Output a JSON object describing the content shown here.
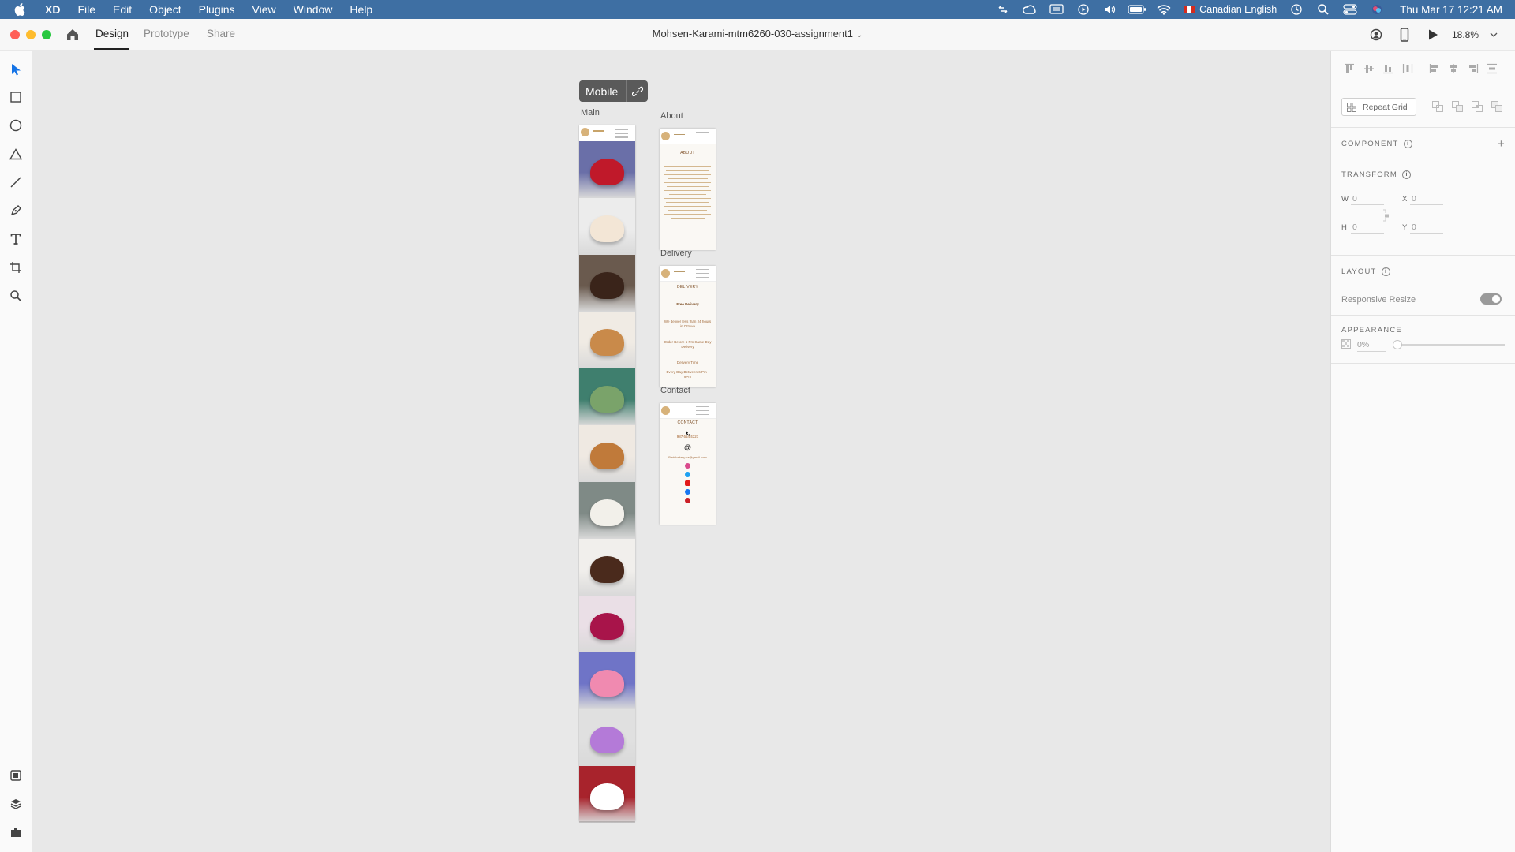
{
  "menubar": {
    "apple_icon": "apple-logo-icon",
    "items": [
      "XD",
      "File",
      "Edit",
      "Object",
      "Plugins",
      "View",
      "Window",
      "Help"
    ],
    "input_source": "Canadian English",
    "clock": "Thu Mar 17  12:21 AM",
    "tray_icons": [
      "cloud-sync-icon",
      "creative-cloud-icon",
      "display-icon",
      "play-circle-icon",
      "volume-icon",
      "battery-icon",
      "wifi-icon",
      "flag-canada-icon",
      "time-machine-icon",
      "spotlight-icon",
      "control-center-icon",
      "siri-icon"
    ]
  },
  "toolbar": {
    "tabs": [
      "Design",
      "Prototype",
      "Share"
    ],
    "active_tab": "Design",
    "document_title": "Mohsen-Karami-mtm6260-030-assignment1",
    "zoom": "18.8%",
    "right_icons": [
      "user-account-icon",
      "mobile-preview-icon",
      "play-icon"
    ]
  },
  "tools": [
    "select-icon",
    "rectangle-icon",
    "ellipse-icon",
    "polygon-icon",
    "line-icon",
    "pen-icon",
    "text-icon",
    "artboard-icon",
    "zoom-icon"
  ],
  "bottom_tools": [
    "assets-icon",
    "layers-icon",
    "plugins-icon"
  ],
  "canvas": {
    "flow_name": "Mobile",
    "artboards": {
      "main": "Main",
      "about": "About",
      "delivery": "Delivery",
      "contact": "Contact"
    },
    "about_content": {
      "title": "ABOUT"
    },
    "delivery_content": {
      "title": "DELIVERY",
      "line1": "Free Delivery",
      "line2": "We deliver less than 24 hours in Ottawa",
      "line3": "Order Before 5 Pm Same Day Delivery",
      "line4": "Delivery Time",
      "line5": "Every Day Between 6 Pm - 9Pm"
    },
    "contact_content": {
      "title": "CONTACT",
      "phone": "987 654 4321",
      "email": "Birdsbakery.ca@gmail.com"
    },
    "tiles": [
      "berry-tart",
      "cupcake",
      "chocolate-dome",
      "cookies",
      "green-bundt-cake",
      "pie",
      "wedding-cake",
      "chocolate-cake",
      "red-velvet-cake",
      "donuts",
      "macarons",
      "christmas-cookies"
    ],
    "colors": {
      "tile_backgrounds": [
        "#6a6fa8",
        "#ececec",
        "#6a5a4e",
        "#f0ebe4",
        "#3f7f6e",
        "#efe9e2",
        "#7f8a86",
        "#f1efec",
        "#eadfe6",
        "#6f74c7",
        "#e0e0e0",
        "#a8232c"
      ]
    }
  },
  "inspector": {
    "repeat_grid": "Repeat Grid",
    "component_title": "COMPONENT",
    "transform_title": "TRANSFORM",
    "w_label": "W",
    "w_value": "0",
    "x_label": "X",
    "x_value": "0",
    "h_label": "H",
    "h_value": "0",
    "y_label": "Y",
    "y_value": "0",
    "layout_title": "LAYOUT",
    "responsive_resize": "Responsive Resize",
    "responsive_resize_on": true,
    "appearance_title": "APPEARANCE",
    "opacity": "0%",
    "opacity_fraction": 0,
    "info_glyph": "i",
    "add_glyph": "+"
  },
  "theme": {
    "menubar_bg": "#3e6fa3",
    "canvas_bg": "#e8e8e8",
    "accent_select": "#1473e6"
  }
}
